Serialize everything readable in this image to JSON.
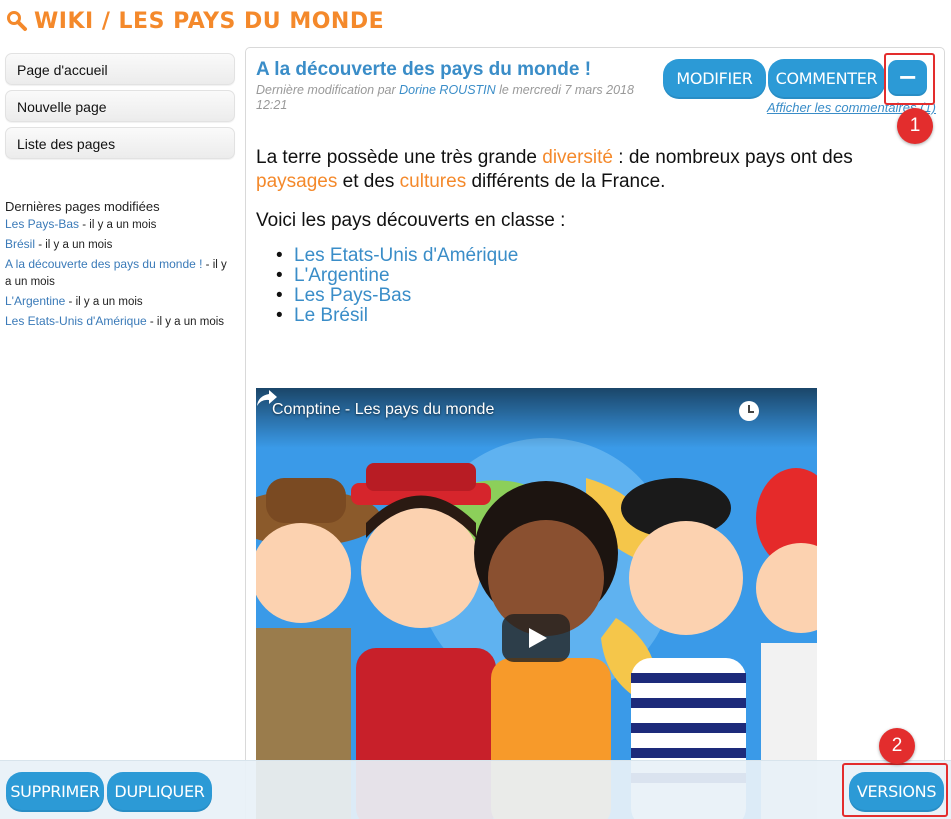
{
  "header": {
    "title": "WIKI / LES PAYS DU MONDE",
    "icon": "search-icon"
  },
  "sidebar": {
    "nav": [
      "Page d'accueil",
      "Nouvelle page",
      "Liste des pages"
    ],
    "recent_title": "Dernières pages modifiées",
    "recent": [
      {
        "link": "Les Pays-Bas",
        "ago": " - il y a un mois"
      },
      {
        "link": "Brésil",
        "ago": " - il y a un mois"
      },
      {
        "link": "A la découverte des pays du monde !",
        "ago": " - il y a un mois"
      },
      {
        "link": "L'Argentine",
        "ago": " - il y a un mois"
      },
      {
        "link": "Les Etats-Unis d'Amérique",
        "ago": " - il y a un mois"
      }
    ]
  },
  "page": {
    "title": "A la découverte des pays du monde !",
    "meta_prefix": "Dernière modification par ",
    "meta_author": "Dorine ROUSTIN",
    "meta_suffix": " le mercredi 7 mars 2018 12:21",
    "comments_link": "Afficher les commentaires (1)",
    "buttons": {
      "modifier": "MODIFIER",
      "commenter": "COMMENTER",
      "collapse": "−"
    },
    "p1_a": "La terre possède une très grande ",
    "p1_hl1": "diversité",
    "p1_b": " : de nombreux pays ont des ",
    "p1_hl2": "paysages",
    "p1_c": " et des ",
    "p1_hl3": "cultures",
    "p1_d": " différents de la France.",
    "p2": "Voici les pays découverts en classe :",
    "countries": [
      "Les Etats-Unis d'Amérique",
      "L'Argentine",
      "Les Pays-Bas",
      "Le Brésil"
    ],
    "video_title": "Comptine - Les pays du monde"
  },
  "bottom": {
    "supprimer": "SUPPRIMER",
    "dupliquer": "DUPLIQUER",
    "versions": "VERSIONS"
  },
  "annotations": {
    "badge1": "1",
    "badge2": "2"
  },
  "colors": {
    "accent": "#f4892b",
    "link": "#3a8dc8",
    "button": "#2c9ad6",
    "annotation": "#e32d2d"
  }
}
